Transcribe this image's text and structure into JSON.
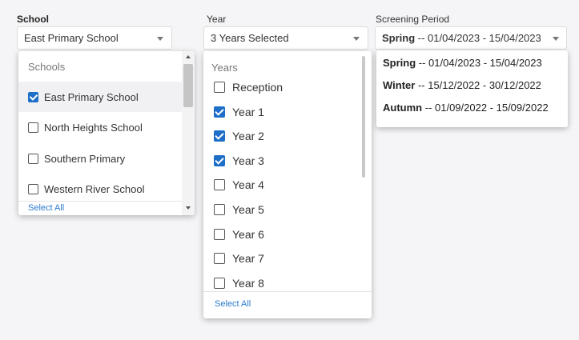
{
  "school": {
    "label": "School",
    "selected": "East Primary School",
    "group_header": "Schools",
    "options": [
      {
        "label": "East Primary School",
        "checked": true
      },
      {
        "label": "North Heights School",
        "checked": false
      },
      {
        "label": "Southern Primary",
        "checked": false
      },
      {
        "label": "Western River School",
        "checked": false
      }
    ],
    "select_all": "Select All"
  },
  "year": {
    "label": "Year",
    "selected": "3 Years Selected",
    "group_header": "Years",
    "options": [
      {
        "label": "Reception",
        "checked": false
      },
      {
        "label": "Year 1",
        "checked": true
      },
      {
        "label": "Year 2",
        "checked": true
      },
      {
        "label": "Year 3",
        "checked": true
      },
      {
        "label": "Year 4",
        "checked": false
      },
      {
        "label": "Year 5",
        "checked": false
      },
      {
        "label": "Year 6",
        "checked": false
      },
      {
        "label": "Year 7",
        "checked": false
      },
      {
        "label": "Year 8",
        "checked": false
      }
    ],
    "select_all": "Select All"
  },
  "period": {
    "label": "Screening Period",
    "selected_term": "Spring",
    "selected_range": " -- 01/04/2023 - 15/04/2023",
    "options": [
      {
        "term": "Spring",
        "range": " -- 01/04/2023 - 15/04/2023"
      },
      {
        "term": "Winter",
        "range": " -- 15/12/2022 - 30/12/2022"
      },
      {
        "term": "Autumn",
        "range": " -- 01/09/2022 - 15/09/2022"
      }
    ]
  },
  "colors": {
    "accent": "#1e6fc8",
    "link": "#2b7bd0",
    "background": "#f5f5f7"
  }
}
